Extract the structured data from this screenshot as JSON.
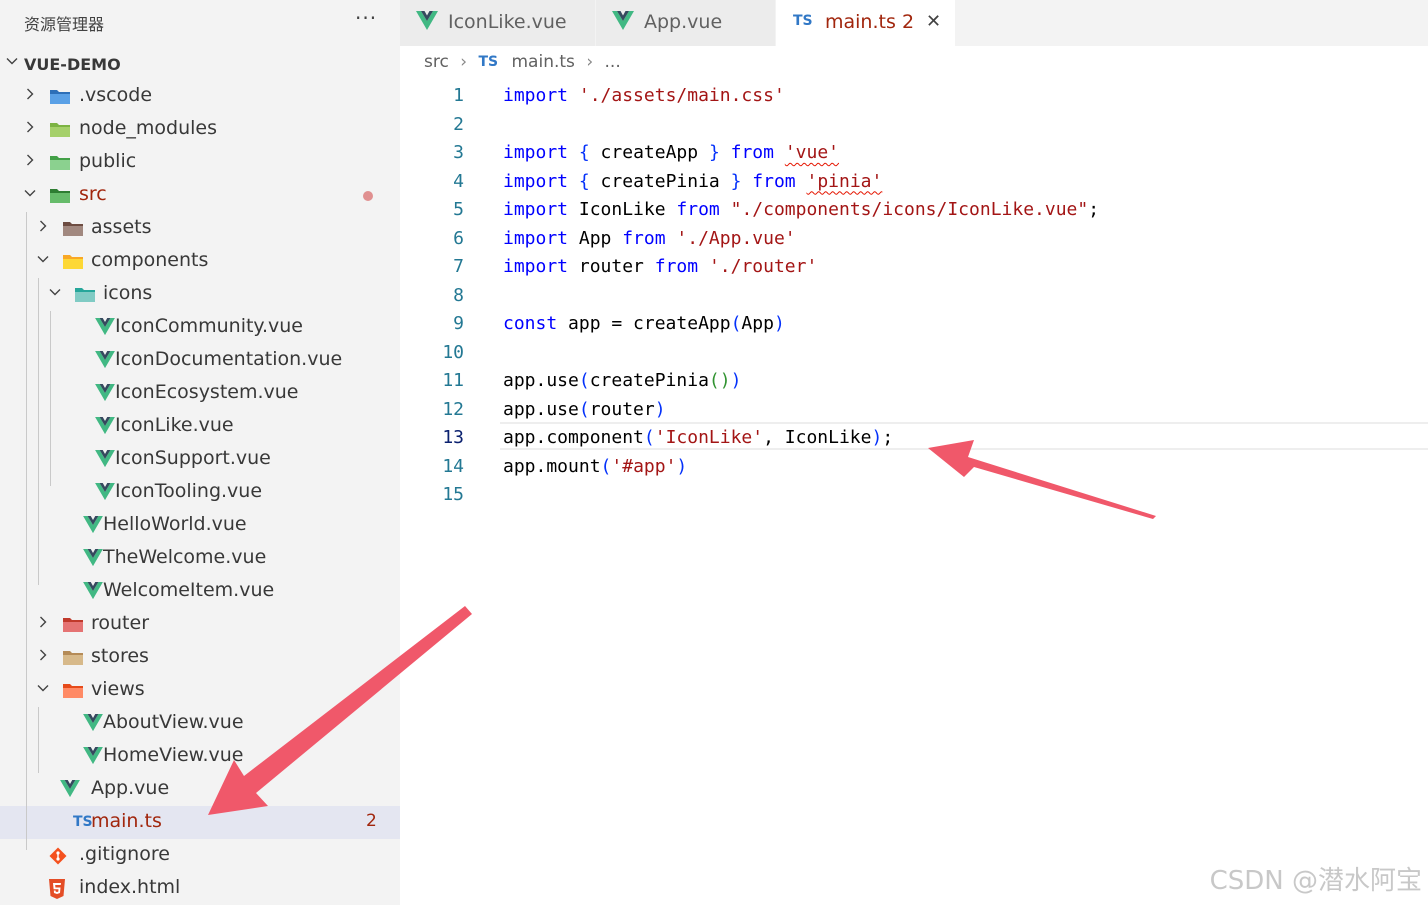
{
  "explorer": {
    "title": "资源管理器",
    "more": "···",
    "root": "VUE-DEMO",
    "items": [
      {
        "label": ".vscode",
        "kind": "folder",
        "icon": "vscode-folder-icon",
        "depth": 0,
        "expanded": false
      },
      {
        "label": "node_modules",
        "kind": "folder",
        "icon": "node-folder-icon",
        "depth": 0,
        "expanded": false
      },
      {
        "label": "public",
        "kind": "folder",
        "icon": "public-folder-icon",
        "depth": 0,
        "expanded": false
      },
      {
        "label": "src",
        "kind": "folder",
        "icon": "src-folder-icon",
        "depth": 0,
        "expanded": true,
        "modified_dot": true,
        "color": "#a1260d"
      },
      {
        "label": "assets",
        "kind": "folder",
        "icon": "assets-folder-icon",
        "depth": 1,
        "expanded": false
      },
      {
        "label": "components",
        "kind": "folder",
        "icon": "components-folder-icon",
        "depth": 1,
        "expanded": true
      },
      {
        "label": "icons",
        "kind": "folder",
        "icon": "icons-folder-icon",
        "depth": 2,
        "expanded": true
      },
      {
        "label": "IconCommunity.vue",
        "kind": "vue",
        "icon": "vue-icon",
        "depth": 3
      },
      {
        "label": "IconDocumentation.vue",
        "kind": "vue",
        "icon": "vue-icon",
        "depth": 3
      },
      {
        "label": "IconEcosystem.vue",
        "kind": "vue",
        "icon": "vue-icon",
        "depth": 3
      },
      {
        "label": "IconLike.vue",
        "kind": "vue",
        "icon": "vue-icon",
        "depth": 3
      },
      {
        "label": "IconSupport.vue",
        "kind": "vue",
        "icon": "vue-icon",
        "depth": 3
      },
      {
        "label": "IconTooling.vue",
        "kind": "vue",
        "icon": "vue-icon",
        "depth": 3
      },
      {
        "label": "HelloWorld.vue",
        "kind": "vue",
        "icon": "vue-icon",
        "depth": 2
      },
      {
        "label": "TheWelcome.vue",
        "kind": "vue",
        "icon": "vue-icon",
        "depth": 2
      },
      {
        "label": "WelcomeItem.vue",
        "kind": "vue",
        "icon": "vue-icon",
        "depth": 2
      },
      {
        "label": "router",
        "kind": "folder",
        "icon": "router-folder-icon",
        "depth": 1,
        "expanded": false
      },
      {
        "label": "stores",
        "kind": "folder",
        "icon": "stores-folder-icon",
        "depth": 1,
        "expanded": false
      },
      {
        "label": "views",
        "kind": "folder",
        "icon": "views-folder-icon",
        "depth": 1,
        "expanded": true
      },
      {
        "label": "AboutView.vue",
        "kind": "vue",
        "icon": "vue-icon",
        "depth": 2
      },
      {
        "label": "HomeView.vue",
        "kind": "vue",
        "icon": "vue-icon",
        "depth": 2
      },
      {
        "label": "App.vue",
        "kind": "vue",
        "icon": "vue-icon",
        "depth": 1
      },
      {
        "label": "main.ts",
        "kind": "ts",
        "icon": "typescript-icon",
        "icon_text": "TS",
        "depth": 1,
        "selected": true,
        "errors": "2",
        "color": "#a1260d"
      },
      {
        "label": ".gitignore",
        "kind": "git",
        "icon": "git-icon",
        "depth": 0
      },
      {
        "label": "index.html",
        "kind": "html",
        "icon": "html5-icon",
        "depth": 0
      }
    ]
  },
  "tabs": [
    {
      "label": "IconLike.vue",
      "icon": "vue-icon",
      "active": false
    },
    {
      "label": "App.vue",
      "icon": "vue-icon",
      "active": false
    },
    {
      "label": "main.ts",
      "icon": "typescript-icon",
      "icon_text": "TS",
      "active": true,
      "errors": "2",
      "close": "✕"
    }
  ],
  "breadcrumb": {
    "segments": [
      "src",
      "main.ts",
      "..."
    ],
    "file_icon_text": "TS",
    "separator": "›"
  },
  "editor": {
    "current_line": 13,
    "lines": [
      "import './assets/main.css'",
      "",
      "import { createApp } from 'vue'",
      "import { createPinia } from 'pinia'",
      "import IconLike from \"./components/icons/IconLike.vue\";",
      "import App from './App.vue'",
      "import router from './router'",
      "",
      "const app = createApp(App)",
      "",
      "app.use(createPinia())",
      "app.use(router)",
      "app.component('IconLike', IconLike);",
      "app.mount('#app')",
      ""
    ]
  },
  "watermark": "CSDN @潜水阿宝",
  "colors": {
    "sidebar_bg": "#f3f3f3",
    "selected_row": "#e4e6f1",
    "error_text": "#a1260d",
    "keyword": "#0000ff",
    "string": "#a31515",
    "line_number": "#237893",
    "vue_green": "#41b883",
    "vue_dark": "#35495e",
    "ts_blue": "#3178c6",
    "annotation_arrow": "#f0586a"
  }
}
